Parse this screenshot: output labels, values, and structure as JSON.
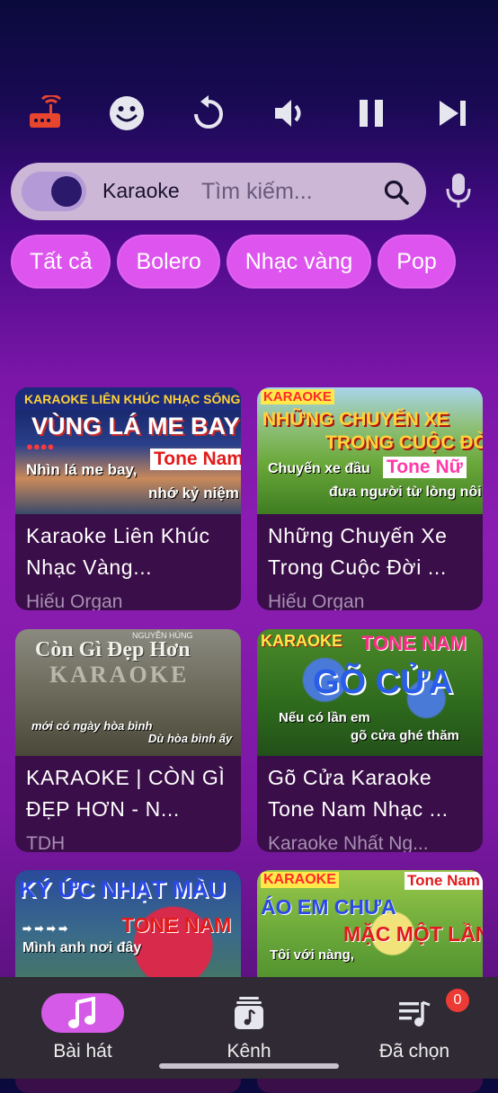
{
  "toolbar": {
    "icons": [
      "router-icon",
      "emoji-icon",
      "replay-icon",
      "volume-icon",
      "pause-icon",
      "skip-next-icon"
    ],
    "accent_color": "#e8452f"
  },
  "search": {
    "mode_label": "Karaoke",
    "placeholder": "Tìm kiếm...",
    "value": ""
  },
  "categories": [
    "Tất cả",
    "Bolero",
    "Nhạc vàng",
    "Pop"
  ],
  "songs": [
    {
      "title": "Karaoke Liên Khúc Nhạc Vàng...",
      "channel": "Hiếu Organ",
      "thumb": {
        "banner": "KARAOKE LIÊN KHÚC NHẠC SỐNG",
        "main": "VÙNG LÁ ME BAY",
        "tone": "Tone Nam",
        "line1": "Nhìn lá me bay,",
        "line2": "nhớ kỷ niệm"
      }
    },
    {
      "title": "Những Chuyến Xe Trong Cuộc Đời ...",
      "channel": "Hiếu Organ",
      "thumb": {
        "banner": "KARAOKE",
        "main": "NHỮNG CHUYẾN XE",
        "main2": "TRONG CUỘC ĐỜI",
        "tone": "Tone Nữ",
        "line1": "Chuyến xe đầu",
        "line2": "đưa người từ lòng nôi"
      }
    },
    {
      "title": "KARAOKE | CÒN GÌ ĐẸP HƠN - N...",
      "channel": "TDH",
      "thumb": {
        "author": "NGUYỄN HÙNG",
        "main": "Còn Gì Đẹp Hơn",
        "sub": "KARAOKE",
        "line1": "mới có ngày hòa bình",
        "line2": "Dù hòa bình ấy"
      }
    },
    {
      "title": "Gõ Cửa Karaoke Tone Nam Nhạc ...",
      "channel": "Karaoke Nhất Ng...",
      "thumb": {
        "banner": "KARAOKE",
        "tone": "TONE NAM",
        "main": "GÕ CỬA",
        "line1": "Nếu có lần em",
        "line2": "gõ cửa ghé thăm"
      }
    },
    {
      "title": "",
      "channel": "",
      "thumb": {
        "main": "KÝ ỨC NHẠT MÀU",
        "tone": "TONE NAM",
        "line1": "Mình anh nơi đây"
      }
    },
    {
      "title": "",
      "channel": "",
      "thumb": {
        "banner": "KARAOKE",
        "tone": "Tone Nam",
        "main": "ÁO EM CHƯA",
        "main2": "MẶC MỘT LẦN",
        "line1": "Tôi với nàng,"
      }
    }
  ],
  "bottom_nav": {
    "items": [
      {
        "label": "Bài hát",
        "icon": "music-note-icon"
      },
      {
        "label": "Kênh",
        "icon": "channel-icon"
      },
      {
        "label": "Đã chọn",
        "icon": "queue-icon"
      }
    ],
    "queue_badge": "0",
    "active_color": "#d65ae8"
  }
}
